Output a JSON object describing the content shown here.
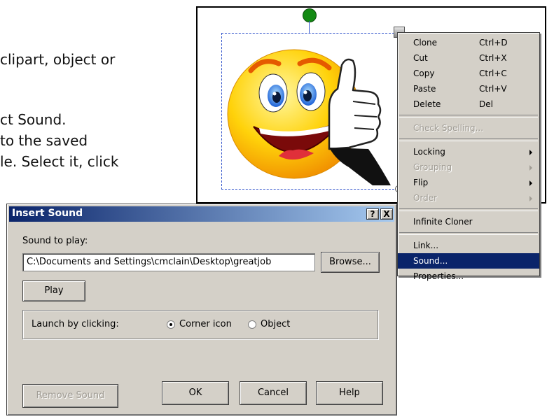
{
  "background_text": {
    "line1": "clipart, object or",
    "line2": "ct Sound.",
    "line3": "to the saved",
    "line4": "le.  Select it, click"
  },
  "context_menu": {
    "items": [
      {
        "label": "Clone",
        "shortcut": "Ctrl+D"
      },
      {
        "label": "Cut",
        "shortcut": "Ctrl+X"
      },
      {
        "label": "Copy",
        "shortcut": "Ctrl+C"
      },
      {
        "label": "Paste",
        "shortcut": "Ctrl+V"
      },
      {
        "label": "Delete",
        "shortcut": "Del"
      },
      {
        "label": "Check Spelling..."
      },
      {
        "label": "Locking"
      },
      {
        "label": "Grouping"
      },
      {
        "label": "Flip"
      },
      {
        "label": "Order"
      },
      {
        "label": "Infinite Cloner"
      },
      {
        "label": "Link..."
      },
      {
        "label": "Sound..."
      },
      {
        "label": "Properties..."
      }
    ],
    "highlight_color": "#0a246a"
  },
  "dialog": {
    "title": "Insert Sound",
    "help_button": "?",
    "close_button": "X",
    "sound_label": "Sound to play:",
    "sound_path": "C:\\Documents and Settings\\cmclain\\Desktop\\greatjob",
    "browse_label": "Browse...",
    "play_label": "Play",
    "launch_label": "Launch by clicking:",
    "option_corner": "Corner icon",
    "option_object": "Object",
    "selected_option": "Corner icon",
    "remove_label": "Remove Sound",
    "ok_label": "OK",
    "cancel_label": "Cancel",
    "help_label": "Help"
  },
  "colors": {
    "titlebar_start": "#0a246a",
    "titlebar_end": "#a6caf0",
    "window_face": "#d4d0c8"
  }
}
